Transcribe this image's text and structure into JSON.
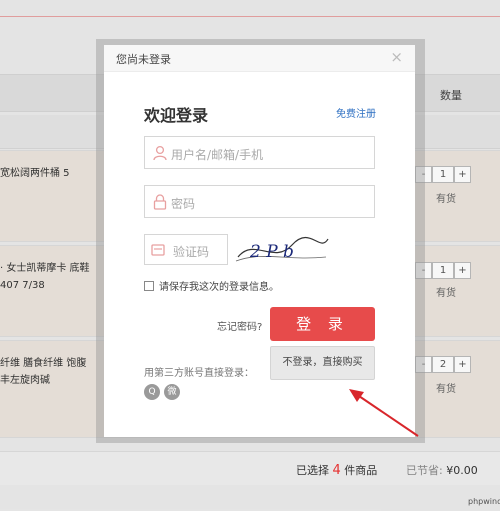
{
  "cart": {
    "qty_header": "数量",
    "items": [
      {
        "name": "宽松阔两件桶 5",
        "qty": "1",
        "stock": "有货"
      },
      {
        "name": "· 女士凯蒂摩卡 底鞋 407 7/38",
        "qty": "1",
        "stock": "有货"
      },
      {
        "name": "纤维 膳食纤维 饱腹丰左旋肉碱",
        "qty": "2",
        "stock": "有货"
      }
    ],
    "stepper_minus": "-",
    "stepper_plus": "+",
    "selected_prefix": "已选择",
    "selected_count": "4",
    "selected_suffix": "件商品",
    "saved_label": "已节省:",
    "saved_value": "¥0.00"
  },
  "modal": {
    "title": "您尚未登录",
    "close": "×",
    "welcome": "欢迎登录",
    "register": "免费注册",
    "username_placeholder": "用户名/邮箱/手机",
    "password_placeholder": "密码",
    "captcha_placeholder": "验证码",
    "captcha_text": "2 P b",
    "remember": "请保存我这次的登录信息。",
    "forgot": "忘记密码?",
    "login": "登 录",
    "third_party": "用第三方账号直接登录：",
    "social": [
      {
        "icon": "qq-icon",
        "glyph": "Q"
      },
      {
        "icon": "weibo-icon",
        "glyph": "微"
      }
    ],
    "no_login": "不登录，直接购买"
  },
  "watermark": "phpwind",
  "colors": {
    "accent": "#e74b4b",
    "link": "#2d6fc2",
    "annotation_arrow": "#d8262b"
  }
}
